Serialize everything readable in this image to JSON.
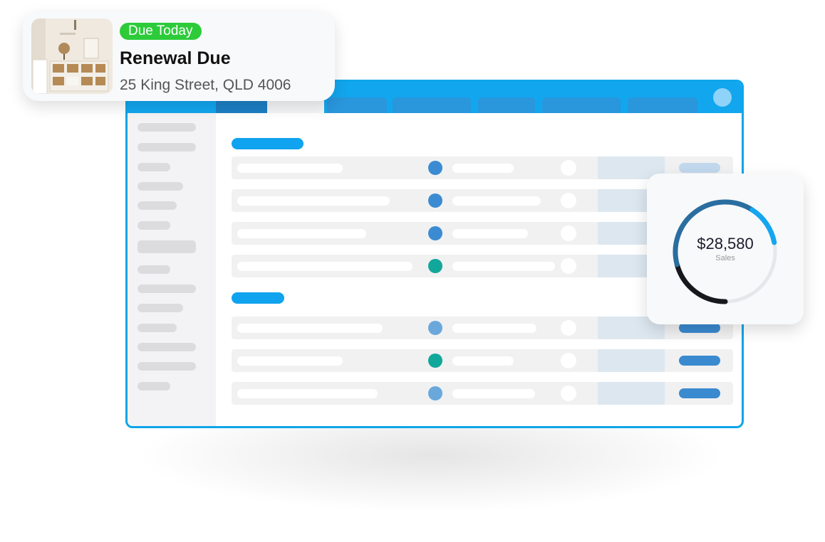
{
  "notification": {
    "badge": "Due Today",
    "title": "Renewal Due",
    "address": "25 King Street, QLD 4006"
  },
  "sales_widget": {
    "value": "$28,580",
    "label": "Sales",
    "progress": 0.72,
    "colors": {
      "primary": "#2a6ea0",
      "accent": "#15a6ef",
      "dark": "#17181c",
      "track": "#e6e7ea"
    }
  },
  "colors": {
    "brand": "#12a6ee",
    "badge": "#2dcb3a",
    "dot_blue": "#3b8bd2",
    "dot_teal": "#11a79a",
    "dot_light": "#6aa8dc"
  }
}
